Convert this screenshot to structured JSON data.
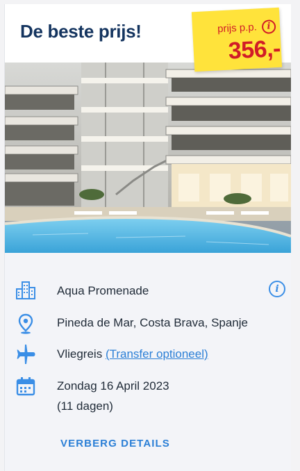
{
  "card": {
    "title": "De beste prijs!",
    "price_label": "prijs p.p.",
    "price": "356,-",
    "colors": {
      "title": "#14345f",
      "price": "#d11c27",
      "tag": "#ffe33b",
      "accent": "#2b7fd6"
    }
  },
  "details": {
    "hotel": {
      "icon": "building-icon",
      "name": "Aqua Promenade"
    },
    "location": {
      "icon": "location-pin-icon",
      "text": "Pineda de Mar, Costa Brava, Spanje"
    },
    "travel": {
      "icon": "airplane-icon",
      "text": "Vliegreis",
      "link": "(Transfer optioneel)"
    },
    "date": {
      "icon": "calendar-icon",
      "text": "Zondag 16 April 2023",
      "duration": "(11 dagen)"
    },
    "toggle_label": "VERBERG DETAILS"
  }
}
